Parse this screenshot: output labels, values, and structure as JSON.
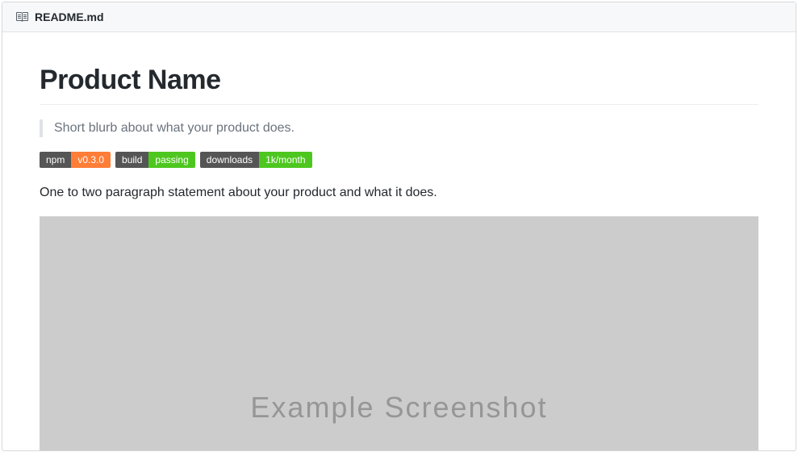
{
  "header": {
    "filename": "README.md"
  },
  "content": {
    "title": "Product Name",
    "blurb": "Short blurb about what your product does.",
    "description": "One to two paragraph statement about your product and what it does.",
    "screenshot_caption": "Example Screenshot"
  },
  "badges": [
    {
      "label": "npm",
      "value": "v0.3.0",
      "color": "orange"
    },
    {
      "label": "build",
      "value": "passing",
      "color": "green"
    },
    {
      "label": "downloads",
      "value": "1k/month",
      "color": "green"
    }
  ]
}
